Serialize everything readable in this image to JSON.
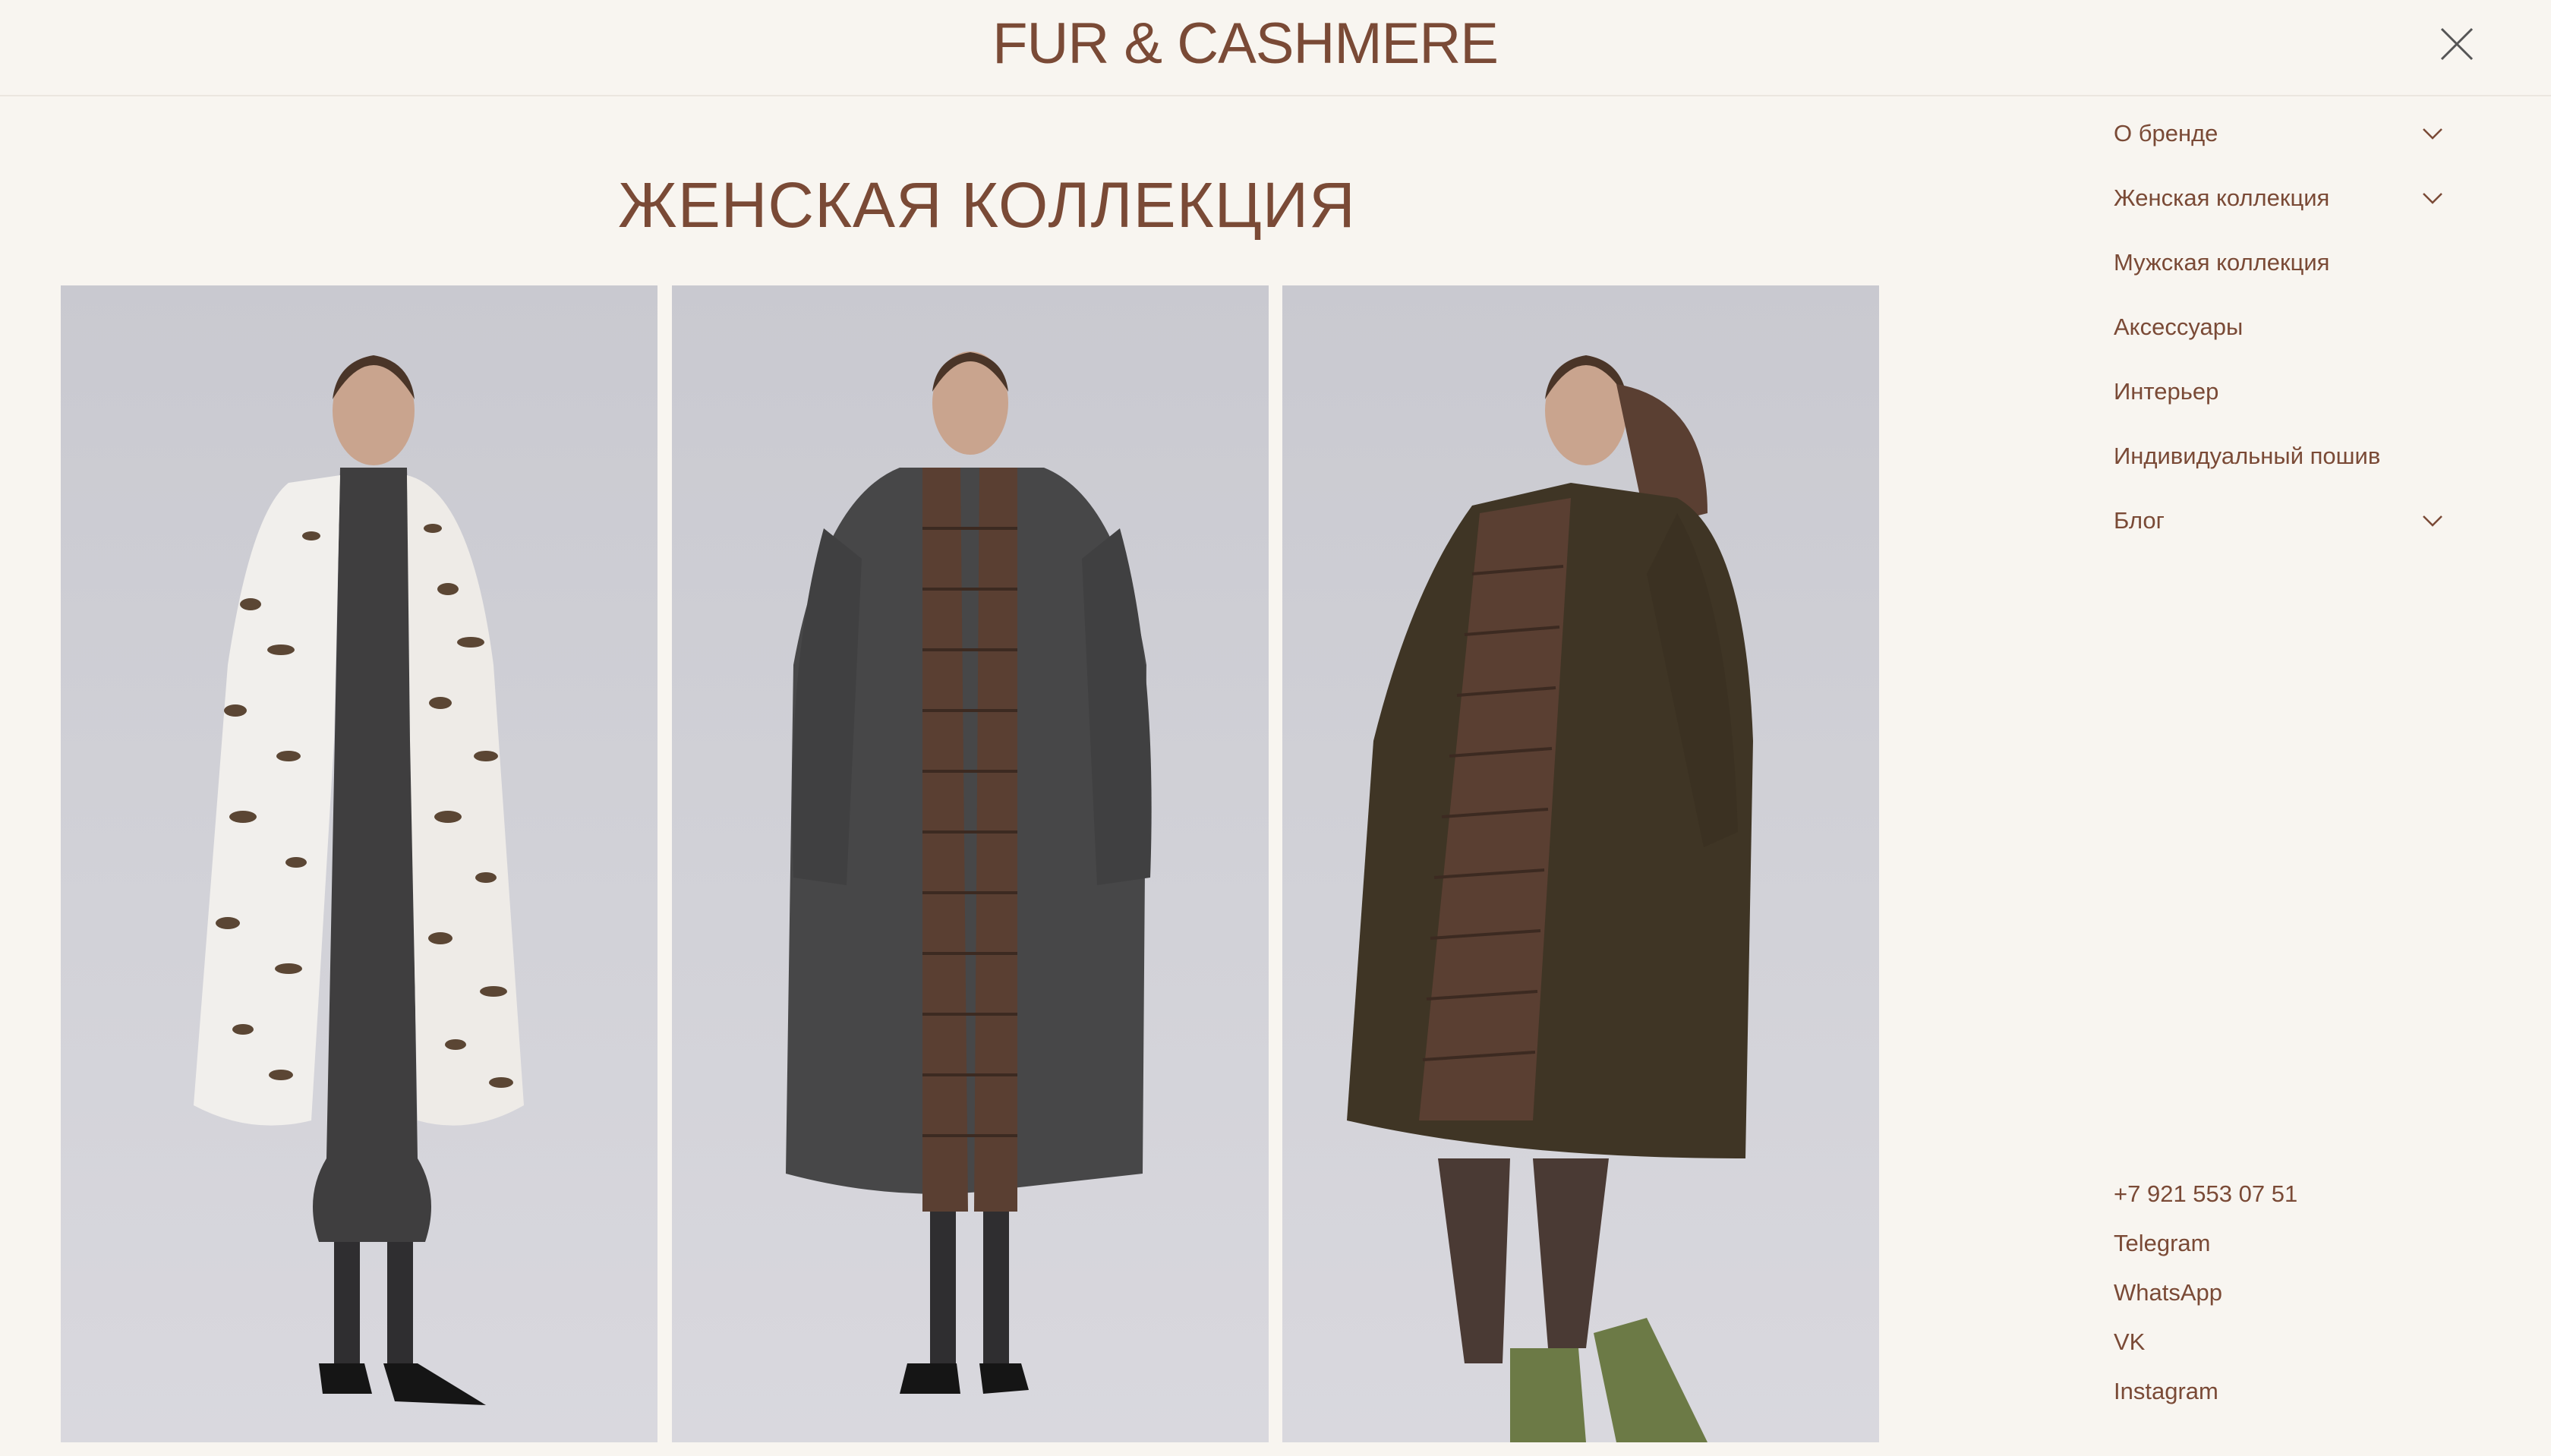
{
  "header": {
    "logo": "FUR & CASHMERE",
    "close_icon": "close-icon"
  },
  "page_title": "ЖЕНСКАЯ КОЛЛЕКЦИЯ",
  "gallery": {
    "items": [
      {
        "name": "white-spotted-fur-coat"
      },
      {
        "name": "grey-cashmere-coat-with-fur-trim"
      },
      {
        "name": "olive-parka-with-fur-lining"
      }
    ]
  },
  "menu": {
    "items": [
      {
        "label": "О бренде",
        "has_dropdown": true,
        "icon": "chevron-down-icon"
      },
      {
        "label": "Женская коллекция",
        "has_dropdown": true,
        "icon": "chevron-down-icon"
      },
      {
        "label": "Мужская коллекция",
        "has_dropdown": false
      },
      {
        "label": "Аксессуары",
        "has_dropdown": false
      },
      {
        "label": "Интерьер",
        "has_dropdown": false
      },
      {
        "label": "Индивидуальный пошив",
        "has_dropdown": false
      },
      {
        "label": "Блог",
        "has_dropdown": true,
        "icon": "chevron-down-icon"
      }
    ]
  },
  "contacts": {
    "phone": "+7 921 553 07 51",
    "telegram": "Telegram",
    "whatsapp": "WhatsApp",
    "vk": "VK",
    "instagram": "Instagram"
  },
  "colors": {
    "background": "#f8f5f0",
    "brand": "#7a4a36",
    "photo_bg": "#cfcfd6"
  }
}
